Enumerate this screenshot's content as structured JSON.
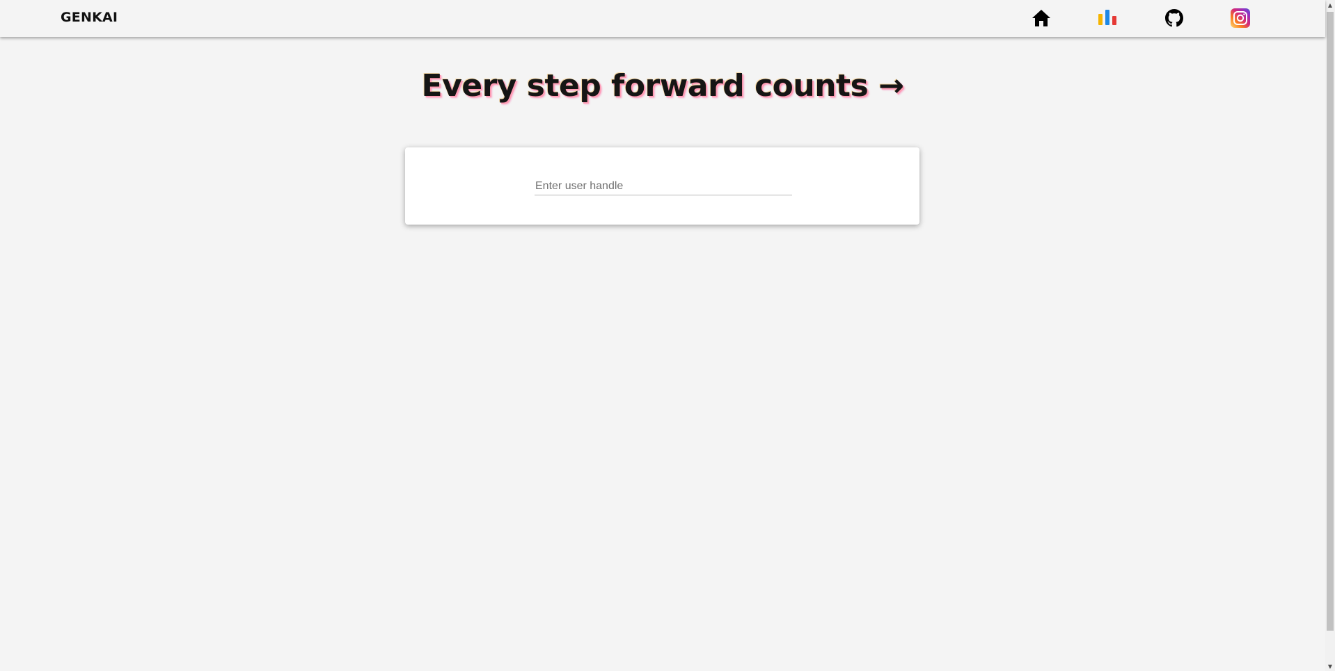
{
  "navbar": {
    "brand": "GENKAI",
    "icons": [
      {
        "name": "home-icon",
        "color": "#000000"
      },
      {
        "name": "bar-chart-icon",
        "colors": [
          "#f5b400",
          "#1e88e5",
          "#e53935"
        ]
      },
      {
        "name": "github-icon",
        "color": "#000000"
      },
      {
        "name": "instagram-icon",
        "colors": [
          "#feda75",
          "#d62976",
          "#962fbf",
          "#4f5bd5"
        ]
      }
    ]
  },
  "main": {
    "headline": "Every step forward counts →",
    "search": {
      "placeholder": "Enter user handle",
      "value": ""
    }
  },
  "scrollbar": {
    "up_arrow": "▲",
    "down_arrow": "▼"
  },
  "colors": {
    "background": "#f4f4f4",
    "card": "#ffffff",
    "headline_shadow": "#ff9db5"
  }
}
